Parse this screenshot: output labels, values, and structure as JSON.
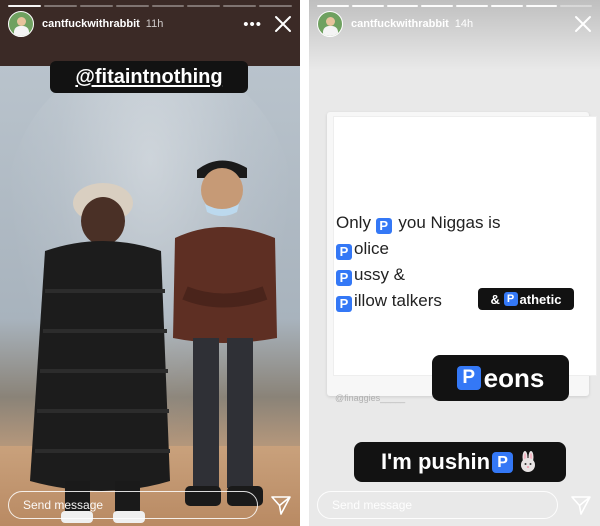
{
  "story_left": {
    "username": "cantfuckwithrabbit",
    "time": "11h",
    "mention": "@fitaintnothing",
    "send_placeholder": "Send message",
    "progress": [
      1,
      0,
      0,
      0,
      0,
      0,
      0,
      0
    ]
  },
  "story_right": {
    "username": "cantfuckwithrabbit",
    "time": "14h",
    "tweet": {
      "line1_pre": "Only ",
      "line1_post": " you Niggas is",
      "line2": "olice",
      "line3": "ussy &",
      "line4": "illow talkers",
      "p_glyph": "P"
    },
    "pathetic_pre": "& ",
    "pathetic_post": "athetic",
    "watermark": "@finaggies_____",
    "peons_post": "eons",
    "pushin_text": "I'm pushin",
    "send_placeholder": "Send message",
    "progress": [
      1,
      1,
      1,
      1,
      1,
      1,
      1,
      0
    ]
  },
  "colors": {
    "sticker_bg": "#121212",
    "p_button_blue": "#3478f6",
    "avatar_green": "#6fa160"
  },
  "icons": [
    "more-icon",
    "close-icon",
    "send-icon",
    "rabbit-icon"
  ]
}
